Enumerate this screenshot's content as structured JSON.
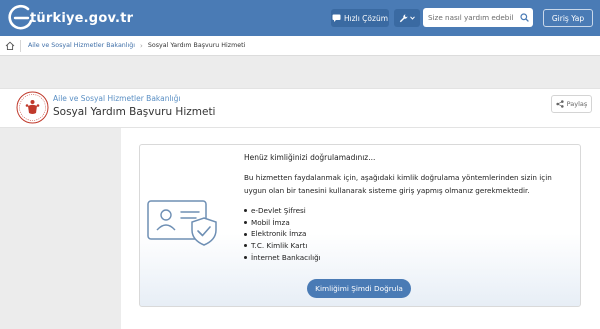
{
  "header": {
    "logo_text": "türkiye.gov.tr",
    "quick_solution_label": "Hızlı Çözüm",
    "search_placeholder": "Size nasıl yardım edebilirim?",
    "login_label": "Giriş Yap",
    "colors": {
      "bar": "#4a7bb5",
      "button": "#3a6aa2"
    }
  },
  "breadcrumb": {
    "items": [
      "Aile ve Sosyal Hizmetler Bakanlığı",
      "Sosyal Yardım Başvuru Hizmeti"
    ]
  },
  "title_card": {
    "ministry": "Aile ve Sosyal Hizmetler Bakanlığı",
    "service": "Sosyal Yardım Başvuru Hizmeti",
    "share_label": "Paylaş"
  },
  "notice": {
    "heading": "Henüz kimliğinizi doğrulamadınız...",
    "description": "Bu hizmetten faydalanmak için, aşağıdaki kimlik doğrulama yöntemlerinden sizin için uygun olan bir tanesini kullanarak sisteme giriş yapmış olmanız gerekmektedir.",
    "methods": [
      "e-Devlet Şifresi",
      "Mobil İmza",
      "Elektronik İmza",
      "T.C. Kimlik Kartı",
      "İnternet Bankacılığı"
    ],
    "verify_button": "Kimliğimi Şimdi Doğrula"
  },
  "icons": [
    "logo-icon",
    "chat-icon",
    "wrench-icon",
    "chevron-down-icon",
    "search-icon",
    "home-icon",
    "ministry-seal-icon",
    "share-icon",
    "identity-card-shield-icon"
  ]
}
